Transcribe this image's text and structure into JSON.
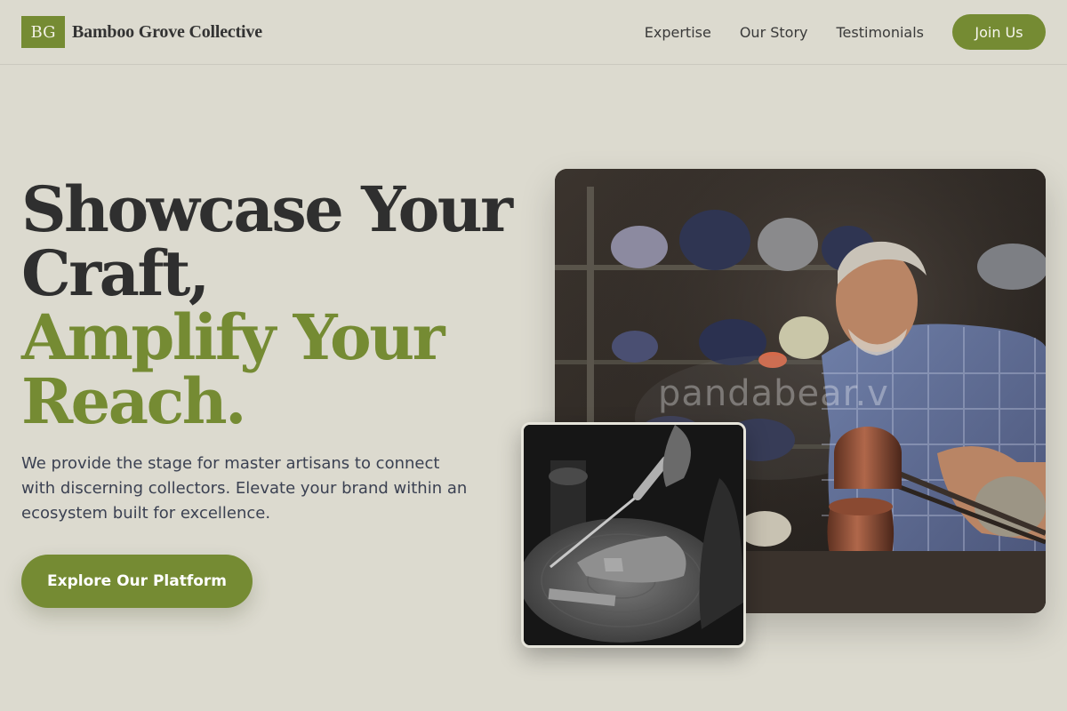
{
  "header": {
    "logo_text": "BG",
    "brand_name": "Bamboo Grove Collective",
    "nav": [
      "Expertise",
      "Our Story",
      "Testimonials"
    ],
    "join_label": "Join Us"
  },
  "hero": {
    "headline_line1": "Showcase Your",
    "headline_line2": "Craft,",
    "headline_line3": "Amplify Your",
    "headline_line4": "Reach.",
    "lead": "We provide the stage for master artisans to connect with discerning collectors. Elevate your brand within an ecosystem built for excellence.",
    "cta_label": "Explore Our Platform"
  },
  "images": {
    "main_watermark": "pandabear.v"
  },
  "colors": {
    "accent": "#758b33",
    "background": "#dcdacf",
    "text_dark": "#2f2f2f"
  }
}
